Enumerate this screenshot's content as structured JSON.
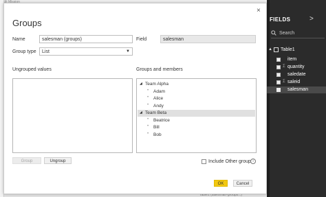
{
  "background": {
    "top_text": "Edit Mission",
    "bottom_text": "Table1 (salesman-groups...)"
  },
  "dialog": {
    "title": "Groups",
    "name_label": "Name",
    "name_value": "salesman (groups)",
    "field_label": "Field",
    "field_value": "salesman",
    "group_type_label": "Group type",
    "group_type_value": "List",
    "ungrouped_label": "Ungrouped values",
    "groups_label": "Groups and members",
    "groups": [
      {
        "name": "Team Alpha",
        "members": [
          "Adam",
          "Alice",
          "Andy"
        ]
      },
      {
        "name": "Team Beta",
        "members": [
          "Beatrice",
          "Bill",
          "Bob"
        ]
      }
    ],
    "group_button": "Group",
    "ungroup_button": "Ungroup",
    "include_other_label": "Include Other group",
    "include_other_checked": false,
    "ok_button": "OK",
    "cancel_button": "Cancel",
    "close_glyph": "×"
  },
  "fields_pane": {
    "title": "FIELDS",
    "search_placeholder": "Search",
    "table": "Table1",
    "fields": [
      {
        "name": "item",
        "sigma": false,
        "selected": true
      },
      {
        "name": "quantity",
        "sigma": true,
        "selected": true
      },
      {
        "name": "saledate",
        "sigma": false,
        "selected": true
      },
      {
        "name": "saleid",
        "sigma": true,
        "selected": false
      },
      {
        "name": "salesman",
        "sigma": false,
        "selected": true
      }
    ]
  },
  "colors": {
    "accent_ok": "#f2c811",
    "fields_bg": "#2b2b2b"
  }
}
